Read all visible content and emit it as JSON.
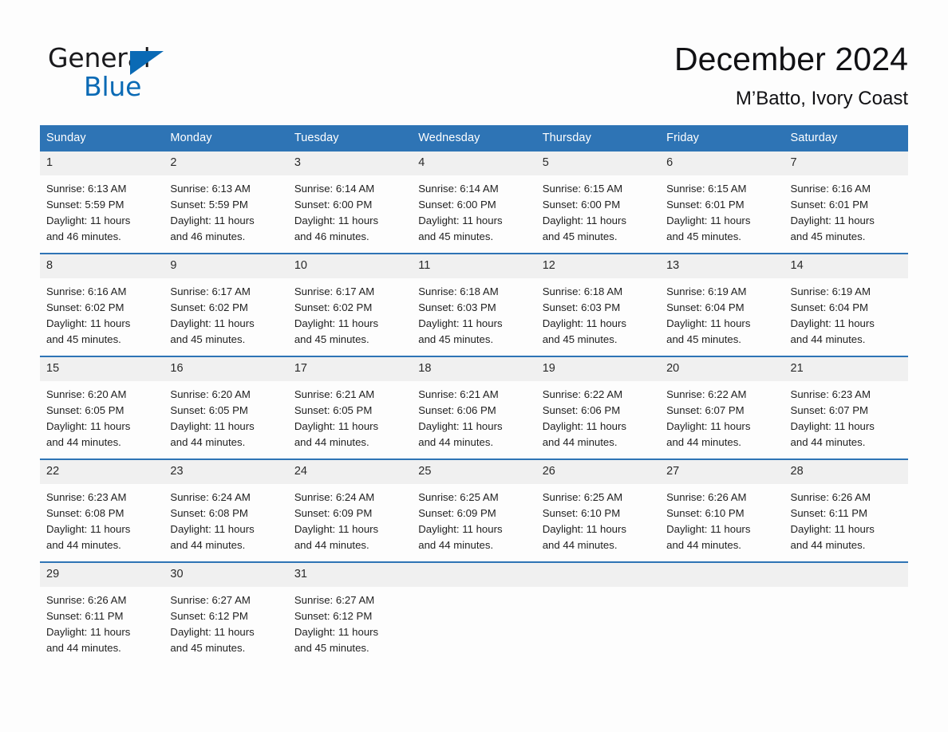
{
  "brand": {
    "name_part1": "General",
    "name_part2": "Blue",
    "logo_icon": "triangle-logo-icon",
    "accent_color": "#0a6ab5"
  },
  "header": {
    "month_title": "December 2024",
    "location": "M’Batto, Ivory Coast"
  },
  "theme": {
    "header_blue": "#2e74b5",
    "daynum_band": "#f0f0f0",
    "page_background": "#fdfdfd"
  },
  "calendar": {
    "weekday_headers": [
      "Sunday",
      "Monday",
      "Tuesday",
      "Wednesday",
      "Thursday",
      "Friday",
      "Saturday"
    ],
    "weeks": [
      [
        {
          "day": "1",
          "sunrise": "Sunrise: 6:13 AM",
          "sunset": "Sunset: 5:59 PM",
          "daylight_line1": "Daylight: 11 hours",
          "daylight_line2": "and 46 minutes."
        },
        {
          "day": "2",
          "sunrise": "Sunrise: 6:13 AM",
          "sunset": "Sunset: 5:59 PM",
          "daylight_line1": "Daylight: 11 hours",
          "daylight_line2": "and 46 minutes."
        },
        {
          "day": "3",
          "sunrise": "Sunrise: 6:14 AM",
          "sunset": "Sunset: 6:00 PM",
          "daylight_line1": "Daylight: 11 hours",
          "daylight_line2": "and 46 minutes."
        },
        {
          "day": "4",
          "sunrise": "Sunrise: 6:14 AM",
          "sunset": "Sunset: 6:00 PM",
          "daylight_line1": "Daylight: 11 hours",
          "daylight_line2": "and 45 minutes."
        },
        {
          "day": "5",
          "sunrise": "Sunrise: 6:15 AM",
          "sunset": "Sunset: 6:00 PM",
          "daylight_line1": "Daylight: 11 hours",
          "daylight_line2": "and 45 minutes."
        },
        {
          "day": "6",
          "sunrise": "Sunrise: 6:15 AM",
          "sunset": "Sunset: 6:01 PM",
          "daylight_line1": "Daylight: 11 hours",
          "daylight_line2": "and 45 minutes."
        },
        {
          "day": "7",
          "sunrise": "Sunrise: 6:16 AM",
          "sunset": "Sunset: 6:01 PM",
          "daylight_line1": "Daylight: 11 hours",
          "daylight_line2": "and 45 minutes."
        }
      ],
      [
        {
          "day": "8",
          "sunrise": "Sunrise: 6:16 AM",
          "sunset": "Sunset: 6:02 PM",
          "daylight_line1": "Daylight: 11 hours",
          "daylight_line2": "and 45 minutes."
        },
        {
          "day": "9",
          "sunrise": "Sunrise: 6:17 AM",
          "sunset": "Sunset: 6:02 PM",
          "daylight_line1": "Daylight: 11 hours",
          "daylight_line2": "and 45 minutes."
        },
        {
          "day": "10",
          "sunrise": "Sunrise: 6:17 AM",
          "sunset": "Sunset: 6:02 PM",
          "daylight_line1": "Daylight: 11 hours",
          "daylight_line2": "and 45 minutes."
        },
        {
          "day": "11",
          "sunrise": "Sunrise: 6:18 AM",
          "sunset": "Sunset: 6:03 PM",
          "daylight_line1": "Daylight: 11 hours",
          "daylight_line2": "and 45 minutes."
        },
        {
          "day": "12",
          "sunrise": "Sunrise: 6:18 AM",
          "sunset": "Sunset: 6:03 PM",
          "daylight_line1": "Daylight: 11 hours",
          "daylight_line2": "and 45 minutes."
        },
        {
          "day": "13",
          "sunrise": "Sunrise: 6:19 AM",
          "sunset": "Sunset: 6:04 PM",
          "daylight_line1": "Daylight: 11 hours",
          "daylight_line2": "and 45 minutes."
        },
        {
          "day": "14",
          "sunrise": "Sunrise: 6:19 AM",
          "sunset": "Sunset: 6:04 PM",
          "daylight_line1": "Daylight: 11 hours",
          "daylight_line2": "and 44 minutes."
        }
      ],
      [
        {
          "day": "15",
          "sunrise": "Sunrise: 6:20 AM",
          "sunset": "Sunset: 6:05 PM",
          "daylight_line1": "Daylight: 11 hours",
          "daylight_line2": "and 44 minutes."
        },
        {
          "day": "16",
          "sunrise": "Sunrise: 6:20 AM",
          "sunset": "Sunset: 6:05 PM",
          "daylight_line1": "Daylight: 11 hours",
          "daylight_line2": "and 44 minutes."
        },
        {
          "day": "17",
          "sunrise": "Sunrise: 6:21 AM",
          "sunset": "Sunset: 6:05 PM",
          "daylight_line1": "Daylight: 11 hours",
          "daylight_line2": "and 44 minutes."
        },
        {
          "day": "18",
          "sunrise": "Sunrise: 6:21 AM",
          "sunset": "Sunset: 6:06 PM",
          "daylight_line1": "Daylight: 11 hours",
          "daylight_line2": "and 44 minutes."
        },
        {
          "day": "19",
          "sunrise": "Sunrise: 6:22 AM",
          "sunset": "Sunset: 6:06 PM",
          "daylight_line1": "Daylight: 11 hours",
          "daylight_line2": "and 44 minutes."
        },
        {
          "day": "20",
          "sunrise": "Sunrise: 6:22 AM",
          "sunset": "Sunset: 6:07 PM",
          "daylight_line1": "Daylight: 11 hours",
          "daylight_line2": "and 44 minutes."
        },
        {
          "day": "21",
          "sunrise": "Sunrise: 6:23 AM",
          "sunset": "Sunset: 6:07 PM",
          "daylight_line1": "Daylight: 11 hours",
          "daylight_line2": "and 44 minutes."
        }
      ],
      [
        {
          "day": "22",
          "sunrise": "Sunrise: 6:23 AM",
          "sunset": "Sunset: 6:08 PM",
          "daylight_line1": "Daylight: 11 hours",
          "daylight_line2": "and 44 minutes."
        },
        {
          "day": "23",
          "sunrise": "Sunrise: 6:24 AM",
          "sunset": "Sunset: 6:08 PM",
          "daylight_line1": "Daylight: 11 hours",
          "daylight_line2": "and 44 minutes."
        },
        {
          "day": "24",
          "sunrise": "Sunrise: 6:24 AM",
          "sunset": "Sunset: 6:09 PM",
          "daylight_line1": "Daylight: 11 hours",
          "daylight_line2": "and 44 minutes."
        },
        {
          "day": "25",
          "sunrise": "Sunrise: 6:25 AM",
          "sunset": "Sunset: 6:09 PM",
          "daylight_line1": "Daylight: 11 hours",
          "daylight_line2": "and 44 minutes."
        },
        {
          "day": "26",
          "sunrise": "Sunrise: 6:25 AM",
          "sunset": "Sunset: 6:10 PM",
          "daylight_line1": "Daylight: 11 hours",
          "daylight_line2": "and 44 minutes."
        },
        {
          "day": "27",
          "sunrise": "Sunrise: 6:26 AM",
          "sunset": "Sunset: 6:10 PM",
          "daylight_line1": "Daylight: 11 hours",
          "daylight_line2": "and 44 minutes."
        },
        {
          "day": "28",
          "sunrise": "Sunrise: 6:26 AM",
          "sunset": "Sunset: 6:11 PM",
          "daylight_line1": "Daylight: 11 hours",
          "daylight_line2": "and 44 minutes."
        }
      ],
      [
        {
          "day": "29",
          "sunrise": "Sunrise: 6:26 AM",
          "sunset": "Sunset: 6:11 PM",
          "daylight_line1": "Daylight: 11 hours",
          "daylight_line2": "and 44 minutes."
        },
        {
          "day": "30",
          "sunrise": "Sunrise: 6:27 AM",
          "sunset": "Sunset: 6:12 PM",
          "daylight_line1": "Daylight: 11 hours",
          "daylight_line2": "and 45 minutes."
        },
        {
          "day": "31",
          "sunrise": "Sunrise: 6:27 AM",
          "sunset": "Sunset: 6:12 PM",
          "daylight_line1": "Daylight: 11 hours",
          "daylight_line2": "and 45 minutes."
        },
        {
          "day": "",
          "sunrise": "",
          "sunset": "",
          "daylight_line1": "",
          "daylight_line2": "",
          "blank": true
        },
        {
          "day": "",
          "sunrise": "",
          "sunset": "",
          "daylight_line1": "",
          "daylight_line2": "",
          "blank": true
        },
        {
          "day": "",
          "sunrise": "",
          "sunset": "",
          "daylight_line1": "",
          "daylight_line2": "",
          "blank": true
        },
        {
          "day": "",
          "sunrise": "",
          "sunset": "",
          "daylight_line1": "",
          "daylight_line2": "",
          "blank": true
        }
      ]
    ]
  }
}
